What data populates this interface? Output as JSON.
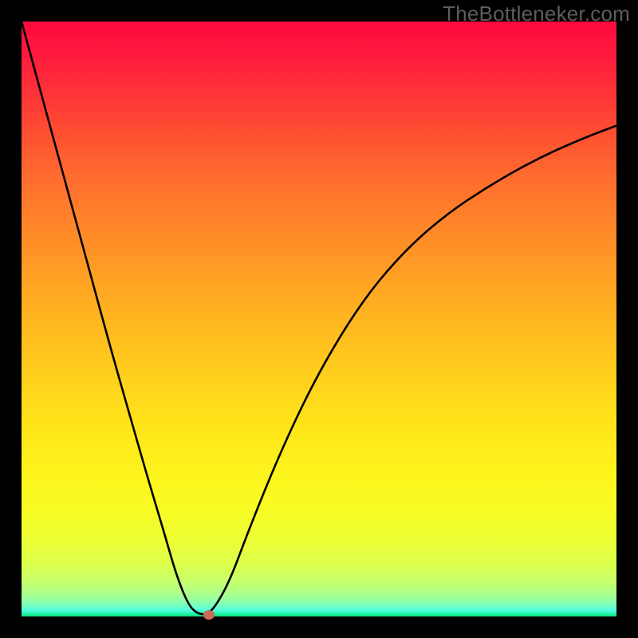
{
  "watermark": "TheBottleneker.com",
  "chart_data": {
    "type": "line",
    "title": "",
    "xlabel": "",
    "ylabel": "",
    "xlim": [
      0,
      100
    ],
    "ylim": [
      0,
      100
    ],
    "background_gradient": {
      "direction": "vertical",
      "stops": [
        {
          "pos": 0,
          "color": "#fe093e"
        },
        {
          "pos": 50,
          "color": "#ffb523"
        },
        {
          "pos": 80,
          "color": "#fcf820"
        },
        {
          "pos": 100,
          "color": "#00e778"
        }
      ],
      "meaning": "top=red (bad), bottom=green (good)"
    },
    "series": [
      {
        "name": "bottleneck-curve",
        "x": [
          0.0,
          3.0,
          6.0,
          9.0,
          12.0,
          15.0,
          18.0,
          21.0,
          24.0,
          26.0,
          28.0,
          29.5,
          31.0,
          32.5,
          35.0,
          38.0,
          42.0,
          46.0,
          50.0,
          55.0,
          60.0,
          66.0,
          72.0,
          78.0,
          84.0,
          90.0,
          96.0,
          100.0
        ],
        "y": [
          100.0,
          89.0,
          78.0,
          67.0,
          56.0,
          45.0,
          34.5,
          24.0,
          14.0,
          7.0,
          2.0,
          0.5,
          0.3,
          1.5,
          6.0,
          14.0,
          24.0,
          33.0,
          41.0,
          49.5,
          56.5,
          63.0,
          68.0,
          72.0,
          75.5,
          78.5,
          81.0,
          82.5
        ]
      }
    ],
    "marker": {
      "x": 31.5,
      "y": 0.3,
      "color": "#c96a5a"
    },
    "notes": "V-shaped bottleneck curve; minimum near x≈31. Values estimated from pixels; chart has no tick labels."
  }
}
